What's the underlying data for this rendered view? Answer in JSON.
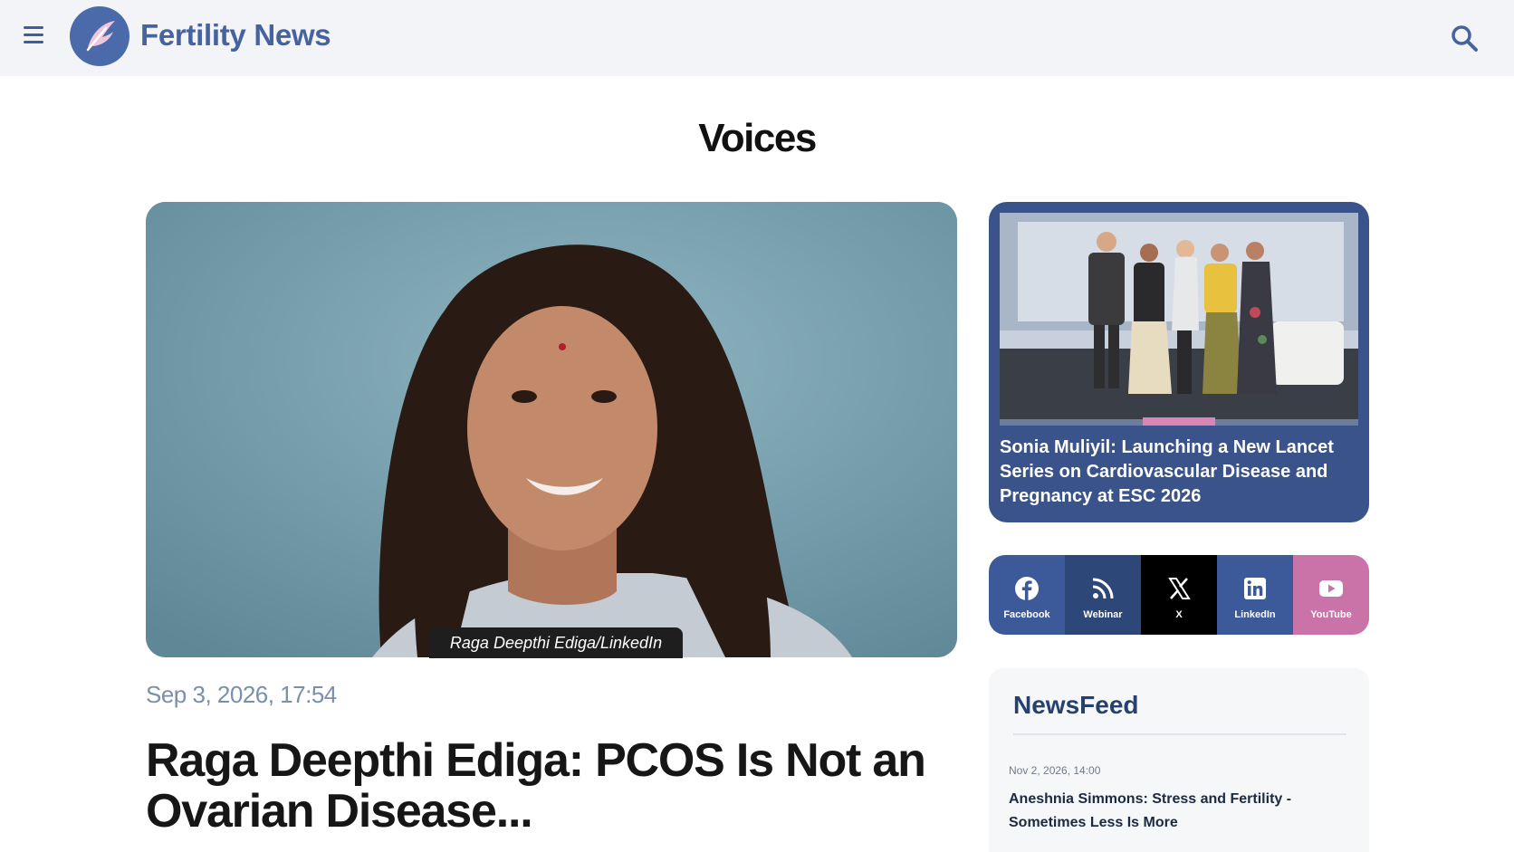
{
  "header": {
    "brand": "Fertility News",
    "menu_icon": "hamburger-menu-icon",
    "logo_icon": "feather-logo-icon",
    "search_icon": "search-icon",
    "background": "#f3f4f7",
    "brand_color": "#46639f"
  },
  "section": {
    "title": "Voices"
  },
  "main_article": {
    "image_caption": "Raga Deepthi Ediga/LinkedIn",
    "date": "Sep 3, 2026, 17:54",
    "headline": "Raga Deepthi Ediga: PCOS Is Not an Ovarian Disease..."
  },
  "side_card": {
    "title": "Sonia Muliyil: Launching a New Lancet Series on Cardiovascular Disease and Pregnancy at ESC 2026",
    "background": "#3a538b"
  },
  "social": [
    {
      "label": "Facebook",
      "icon": "facebook-icon",
      "color": "#3c5a9a"
    },
    {
      "label": "Webinar",
      "icon": "rss-icon",
      "color": "#2d4778"
    },
    {
      "label": "X",
      "icon": "x-icon",
      "color": "#000000"
    },
    {
      "label": "LinkedIn",
      "icon": "linkedin-icon",
      "color": "#3c5a9a"
    },
    {
      "label": "YouTube",
      "icon": "youtube-icon",
      "color": "#c973a8"
    }
  ],
  "newsfeed": {
    "title": "NewsFeed",
    "items": [
      {
        "date": "Nov 2, 2026, 14:00",
        "title": "Aneshnia Simmons: Stress and Fertility - Sometimes Less Is More"
      }
    ]
  }
}
